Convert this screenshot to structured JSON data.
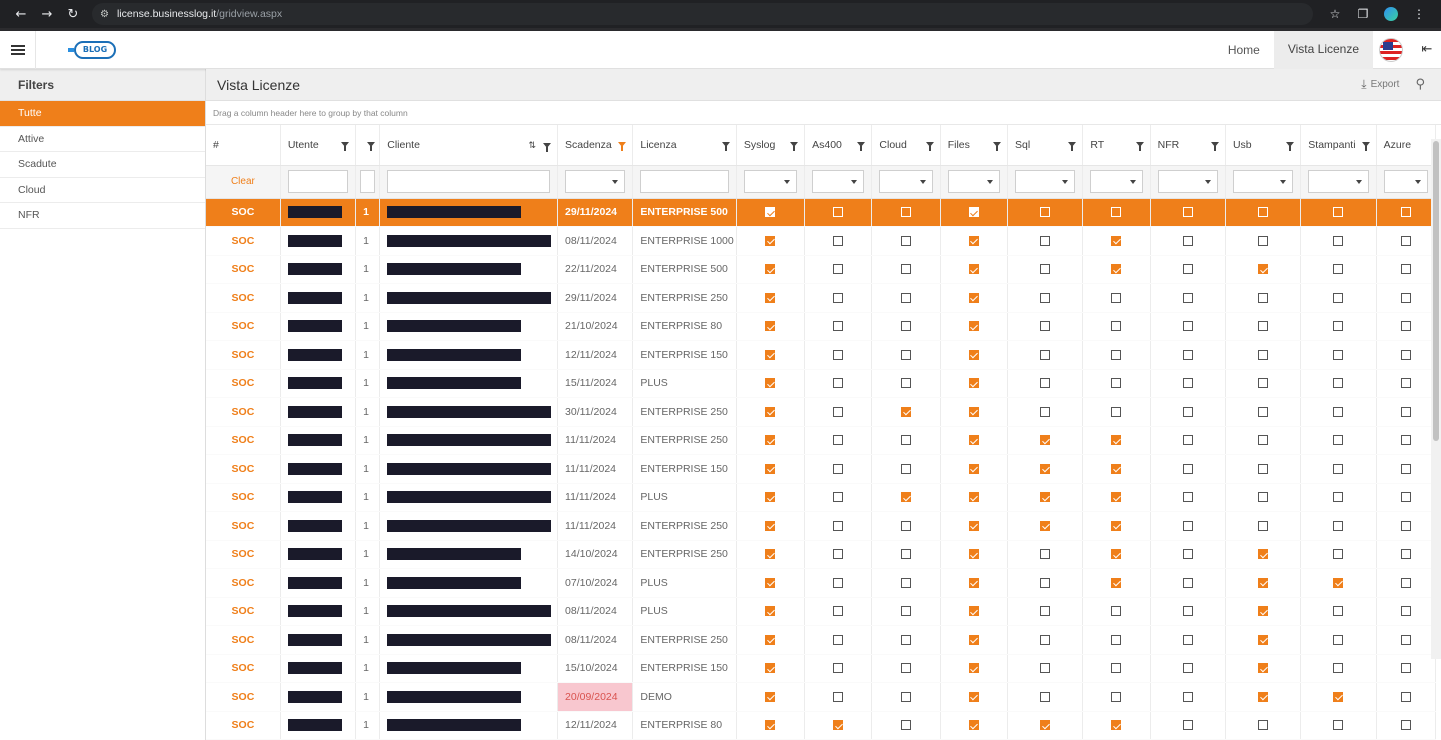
{
  "browser": {
    "host": "license.businesslog.it",
    "path": "/gridview.aspx"
  },
  "app": {
    "logo_text": "BLOG"
  },
  "topnav": [
    {
      "label": "Home",
      "active": false
    },
    {
      "label": "Vista Licenze",
      "active": true
    }
  ],
  "sidebar": {
    "title": "Filters",
    "items": [
      {
        "label": "Tutte",
        "active": true
      },
      {
        "label": "Attive",
        "active": false
      },
      {
        "label": "Scadute",
        "active": false
      },
      {
        "label": "Cloud",
        "active": false
      },
      {
        "label": "NFR",
        "active": false
      }
    ]
  },
  "page": {
    "title": "Vista Licenze",
    "export_label": "Export",
    "group_hint": "Drag a column header here to group by that column",
    "clear_label": "Clear"
  },
  "columns": [
    "#",
    "Utente",
    "",
    "Cliente",
    "Scadenza",
    "Licenza",
    "Syslog",
    "As400",
    "Cloud",
    "Files",
    "Sql",
    "RT",
    "NFR",
    "Usb",
    "Stampanti",
    "Azure"
  ],
  "colors": {
    "accent": "#ef7f1a",
    "expired_bg": "#f8c7cf",
    "expired_text": "#d9534f"
  },
  "rows": [
    {
      "id": "SOC",
      "qty": "1",
      "scadenza": "29/11/2024",
      "licenza": "ENTERPRISE 500",
      "flags": [
        1,
        0,
        0,
        1,
        0,
        0,
        0,
        0,
        0,
        0
      ],
      "selected": true,
      "expired": false,
      "u": 54,
      "c": 134
    },
    {
      "id": "SOC",
      "qty": "1",
      "scadenza": "08/11/2024",
      "licenza": "ENTERPRISE 1000",
      "flags": [
        1,
        0,
        0,
        1,
        0,
        1,
        0,
        0,
        0,
        0
      ],
      "selected": false,
      "expired": false,
      "u": 54,
      "c": 164
    },
    {
      "id": "SOC",
      "qty": "1",
      "scadenza": "22/11/2024",
      "licenza": "ENTERPRISE 500",
      "flags": [
        1,
        0,
        0,
        1,
        0,
        1,
        0,
        1,
        0,
        0
      ],
      "selected": false,
      "expired": false,
      "u": 54,
      "c": 134
    },
    {
      "id": "SOC",
      "qty": "1",
      "scadenza": "29/11/2024",
      "licenza": "ENTERPRISE 250",
      "flags": [
        1,
        0,
        0,
        1,
        0,
        0,
        0,
        0,
        0,
        0
      ],
      "selected": false,
      "expired": false,
      "u": 54,
      "c": 164
    },
    {
      "id": "SOC",
      "qty": "1",
      "scadenza": "21/10/2024",
      "licenza": "ENTERPRISE 80",
      "flags": [
        1,
        0,
        0,
        1,
        0,
        0,
        0,
        0,
        0,
        0
      ],
      "selected": false,
      "expired": false,
      "u": 54,
      "c": 134
    },
    {
      "id": "SOC",
      "qty": "1",
      "scadenza": "12/11/2024",
      "licenza": "ENTERPRISE 150",
      "flags": [
        1,
        0,
        0,
        1,
        0,
        0,
        0,
        0,
        0,
        0
      ],
      "selected": false,
      "expired": false,
      "u": 54,
      "c": 134
    },
    {
      "id": "SOC",
      "qty": "1",
      "scadenza": "15/11/2024",
      "licenza": "PLUS",
      "flags": [
        1,
        0,
        0,
        1,
        0,
        0,
        0,
        0,
        0,
        0
      ],
      "selected": false,
      "expired": false,
      "u": 54,
      "c": 134
    },
    {
      "id": "SOC",
      "qty": "1",
      "scadenza": "30/11/2024",
      "licenza": "ENTERPRISE 250",
      "flags": [
        1,
        0,
        1,
        1,
        0,
        0,
        0,
        0,
        0,
        0
      ],
      "selected": false,
      "expired": false,
      "u": 54,
      "c": 164
    },
    {
      "id": "SOC",
      "qty": "1",
      "scadenza": "11/11/2024",
      "licenza": "ENTERPRISE 250",
      "flags": [
        1,
        0,
        0,
        1,
        1,
        1,
        0,
        0,
        0,
        0
      ],
      "selected": false,
      "expired": false,
      "u": 54,
      "c": 164
    },
    {
      "id": "SOC",
      "qty": "1",
      "scadenza": "11/11/2024",
      "licenza": "ENTERPRISE 150",
      "flags": [
        1,
        0,
        0,
        1,
        1,
        1,
        0,
        0,
        0,
        0
      ],
      "selected": false,
      "expired": false,
      "u": 54,
      "c": 164
    },
    {
      "id": "SOC",
      "qty": "1",
      "scadenza": "11/11/2024",
      "licenza": "PLUS",
      "flags": [
        1,
        0,
        1,
        1,
        1,
        1,
        0,
        0,
        0,
        0
      ],
      "selected": false,
      "expired": false,
      "u": 54,
      "c": 164
    },
    {
      "id": "SOC",
      "qty": "1",
      "scadenza": "11/11/2024",
      "licenza": "ENTERPRISE 250",
      "flags": [
        1,
        0,
        0,
        1,
        1,
        1,
        0,
        0,
        0,
        0
      ],
      "selected": false,
      "expired": false,
      "u": 54,
      "c": 164
    },
    {
      "id": "SOC",
      "qty": "1",
      "scadenza": "14/10/2024",
      "licenza": "ENTERPRISE 250",
      "flags": [
        1,
        0,
        0,
        1,
        0,
        1,
        0,
        1,
        0,
        0
      ],
      "selected": false,
      "expired": false,
      "u": 54,
      "c": 134
    },
    {
      "id": "SOC",
      "qty": "1",
      "scadenza": "07/10/2024",
      "licenza": "PLUS",
      "flags": [
        1,
        0,
        0,
        1,
        0,
        1,
        0,
        1,
        1,
        0
      ],
      "selected": false,
      "expired": false,
      "u": 54,
      "c": 134
    },
    {
      "id": "SOC",
      "qty": "1",
      "scadenza": "08/11/2024",
      "licenza": "PLUS",
      "flags": [
        1,
        0,
        0,
        1,
        0,
        0,
        0,
        1,
        0,
        0
      ],
      "selected": false,
      "expired": false,
      "u": 54,
      "c": 164
    },
    {
      "id": "SOC",
      "qty": "1",
      "scadenza": "08/11/2024",
      "licenza": "ENTERPRISE 250",
      "flags": [
        1,
        0,
        0,
        1,
        0,
        0,
        0,
        1,
        0,
        0
      ],
      "selected": false,
      "expired": false,
      "u": 54,
      "c": 164
    },
    {
      "id": "SOC",
      "qty": "1",
      "scadenza": "15/10/2024",
      "licenza": "ENTERPRISE 150",
      "flags": [
        1,
        0,
        0,
        1,
        0,
        0,
        0,
        1,
        0,
        0
      ],
      "selected": false,
      "expired": false,
      "u": 54,
      "c": 134
    },
    {
      "id": "SOC",
      "qty": "1",
      "scadenza": "20/09/2024",
      "licenza": "DEMO",
      "flags": [
        1,
        0,
        0,
        1,
        0,
        0,
        0,
        1,
        1,
        0
      ],
      "selected": false,
      "expired": true,
      "u": 54,
      "c": 134
    },
    {
      "id": "SOC",
      "qty": "1",
      "scadenza": "12/11/2024",
      "licenza": "ENTERPRISE 80",
      "flags": [
        1,
        1,
        0,
        1,
        1,
        1,
        0,
        0,
        0,
        0
      ],
      "selected": false,
      "expired": false,
      "u": 54,
      "c": 134
    }
  ]
}
